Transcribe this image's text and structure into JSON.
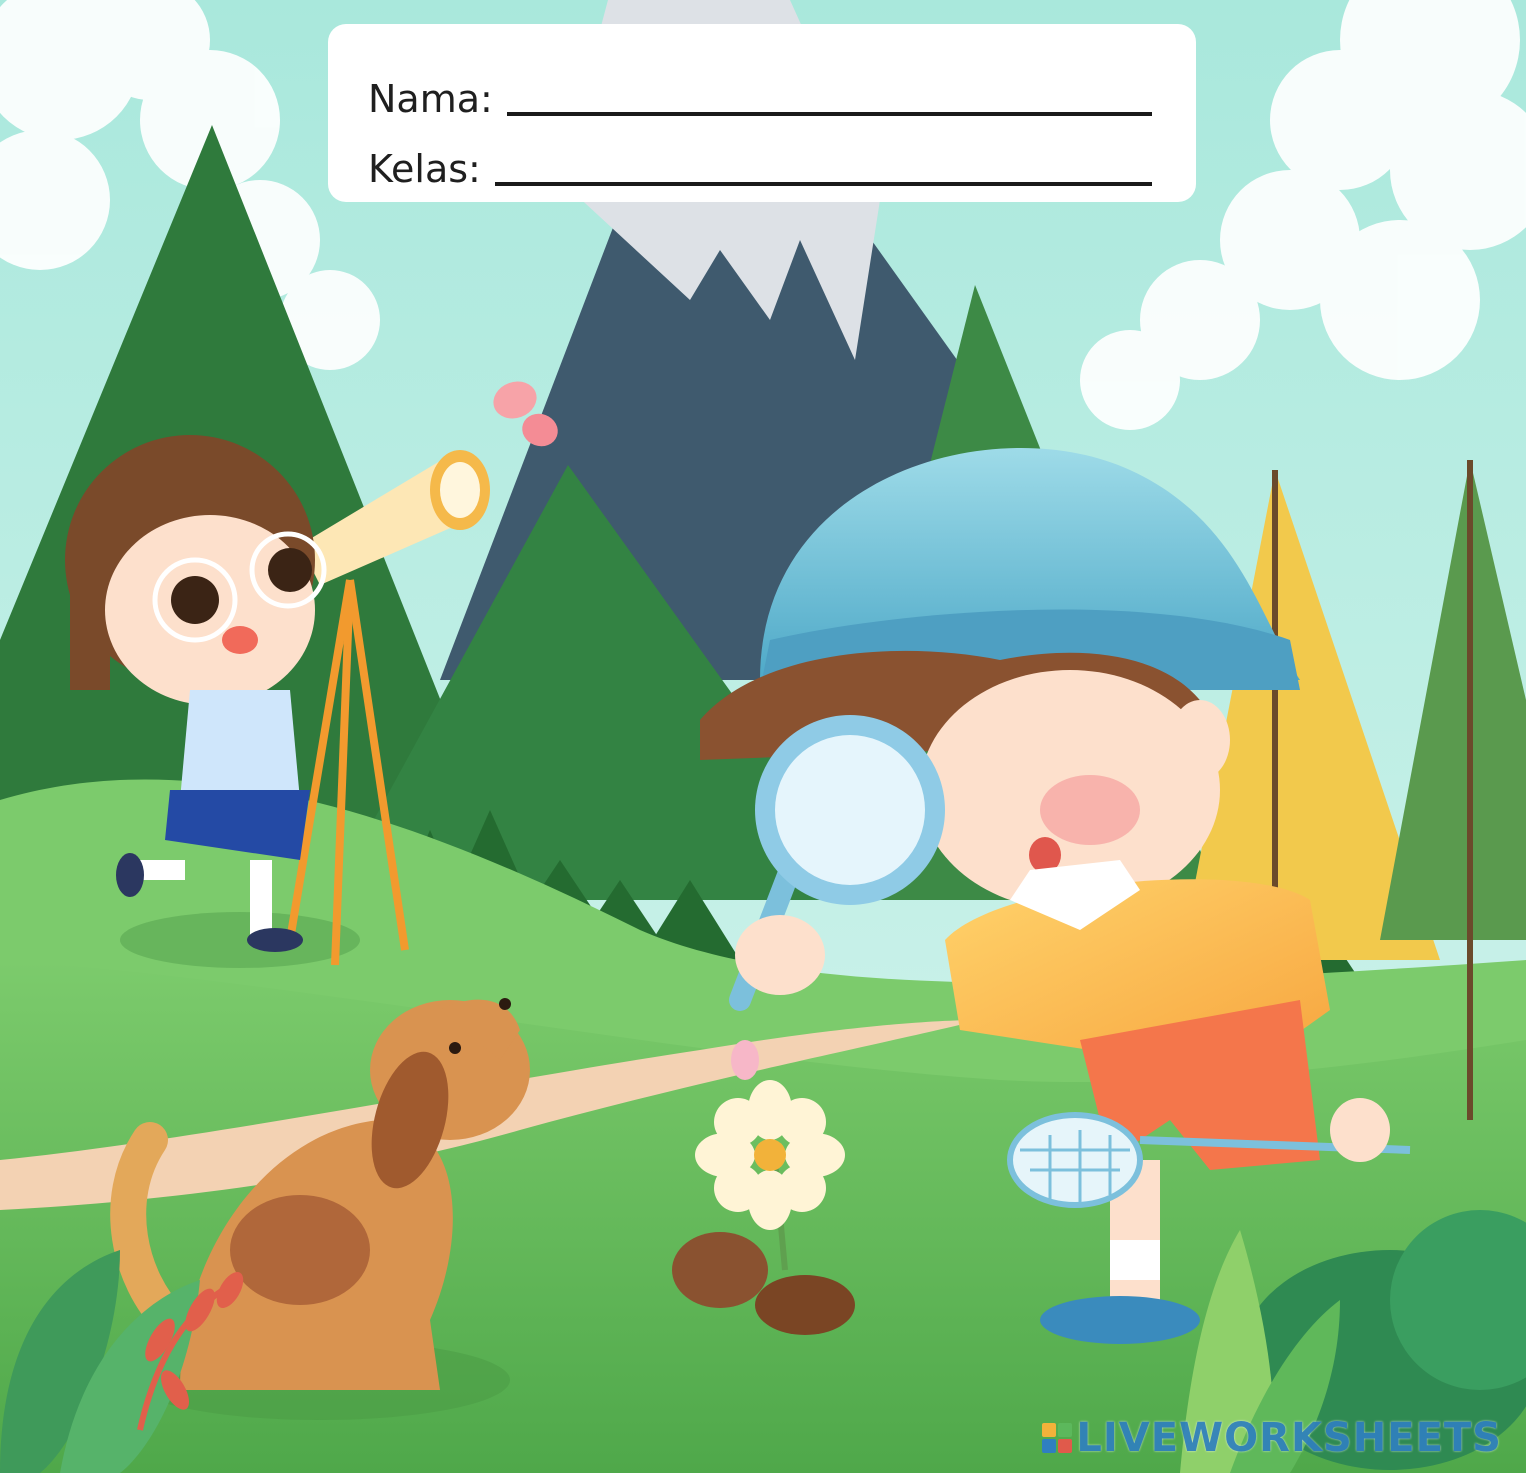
{
  "worksheet": {
    "name_label": "Nama:",
    "class_label": "Kelas:"
  },
  "watermark": {
    "text": "LIVEWORKSHEETS",
    "logo_letters": [
      "L",
      "I",
      "V",
      "E"
    ]
  },
  "colors": {
    "sky": "#b7ecdf",
    "mountain_dark_green": "#2f7a3c",
    "mountain_slate": "#3f5a6e",
    "snow": "#dde1e6",
    "grass": "#6dbf5e",
    "path": "#f3d2b3",
    "brand_blue": "#2f7fc1"
  },
  "illustration": {
    "subjects": [
      "girl-with-telescope",
      "boy-with-magnifier",
      "dog",
      "butterfly",
      "flower",
      "net"
    ]
  }
}
